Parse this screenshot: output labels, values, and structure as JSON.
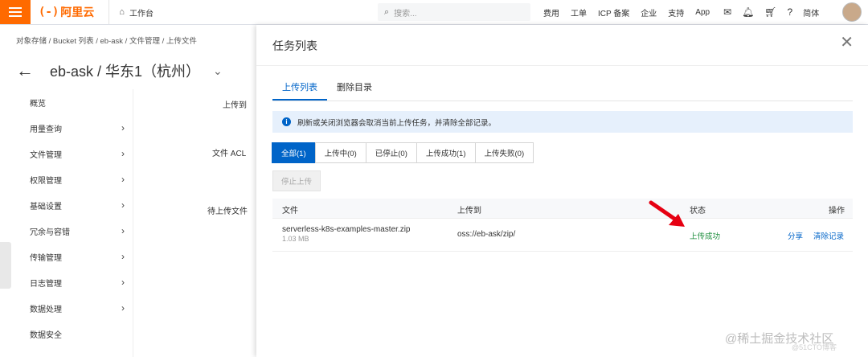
{
  "topbar": {
    "brand": "阿里云",
    "brand_mark": "(-)",
    "workbench": "工作台",
    "search_placeholder": "搜索...",
    "links": [
      "费用",
      "工单",
      "ICP 备案",
      "企业",
      "支持",
      "App"
    ],
    "lang": "简体"
  },
  "page": {
    "breadcrumb": "对象存储 / Bucket 列表 / eb-ask / 文件管理 / 上传文件",
    "bucket_title": "eb-ask / 华东1（杭州）",
    "sidebar": [
      {
        "label": "概览",
        "arrow": false
      },
      {
        "label": "用量查询",
        "arrow": true
      },
      {
        "label": "文件管理",
        "arrow": true
      },
      {
        "label": "权限管理",
        "arrow": true
      },
      {
        "label": "基础设置",
        "arrow": true
      },
      {
        "label": "冗余与容错",
        "arrow": true
      },
      {
        "label": "传输管理",
        "arrow": true
      },
      {
        "label": "日志管理",
        "arrow": true
      },
      {
        "label": "数据处理",
        "arrow": true
      },
      {
        "label": "数据安全",
        "arrow": false
      }
    ],
    "form_labels": {
      "upload_to": "上传到",
      "file_acl": "文件 ACL",
      "pending": "待上传文件"
    }
  },
  "drawer": {
    "title": "任务列表",
    "tabs": [
      {
        "label": "上传列表",
        "active": true
      },
      {
        "label": "删除目录",
        "active": false
      }
    ],
    "notice": "刷新或关闭浏览器会取消当前上传任务，并清除全部记录。",
    "filters": [
      {
        "label": "全部(1)",
        "active": true
      },
      {
        "label": "上传中(0)",
        "active": false
      },
      {
        "label": "已停止(0)",
        "active": false
      },
      {
        "label": "上传成功(1)",
        "active": false
      },
      {
        "label": "上传失败(0)",
        "active": false
      }
    ],
    "stop_button": "停止上传",
    "columns": {
      "file": "文件",
      "dest": "上传到",
      "status": "状态",
      "action": "操作"
    },
    "rows": [
      {
        "file": "serverless-k8s-examples-master.zip",
        "size": "1.03 MB",
        "dest": "oss://eb-ask/zip/",
        "status": "上传成功",
        "actions": [
          "分享",
          "清除记录"
        ]
      }
    ]
  },
  "watermark": {
    "main": "@稀土掘金技术社区",
    "sub": "@51CTO博客"
  },
  "colors": {
    "brand": "#ff6a00",
    "primary": "#0064c8",
    "success": "#1e8e3e",
    "annotation": "#e60012"
  }
}
